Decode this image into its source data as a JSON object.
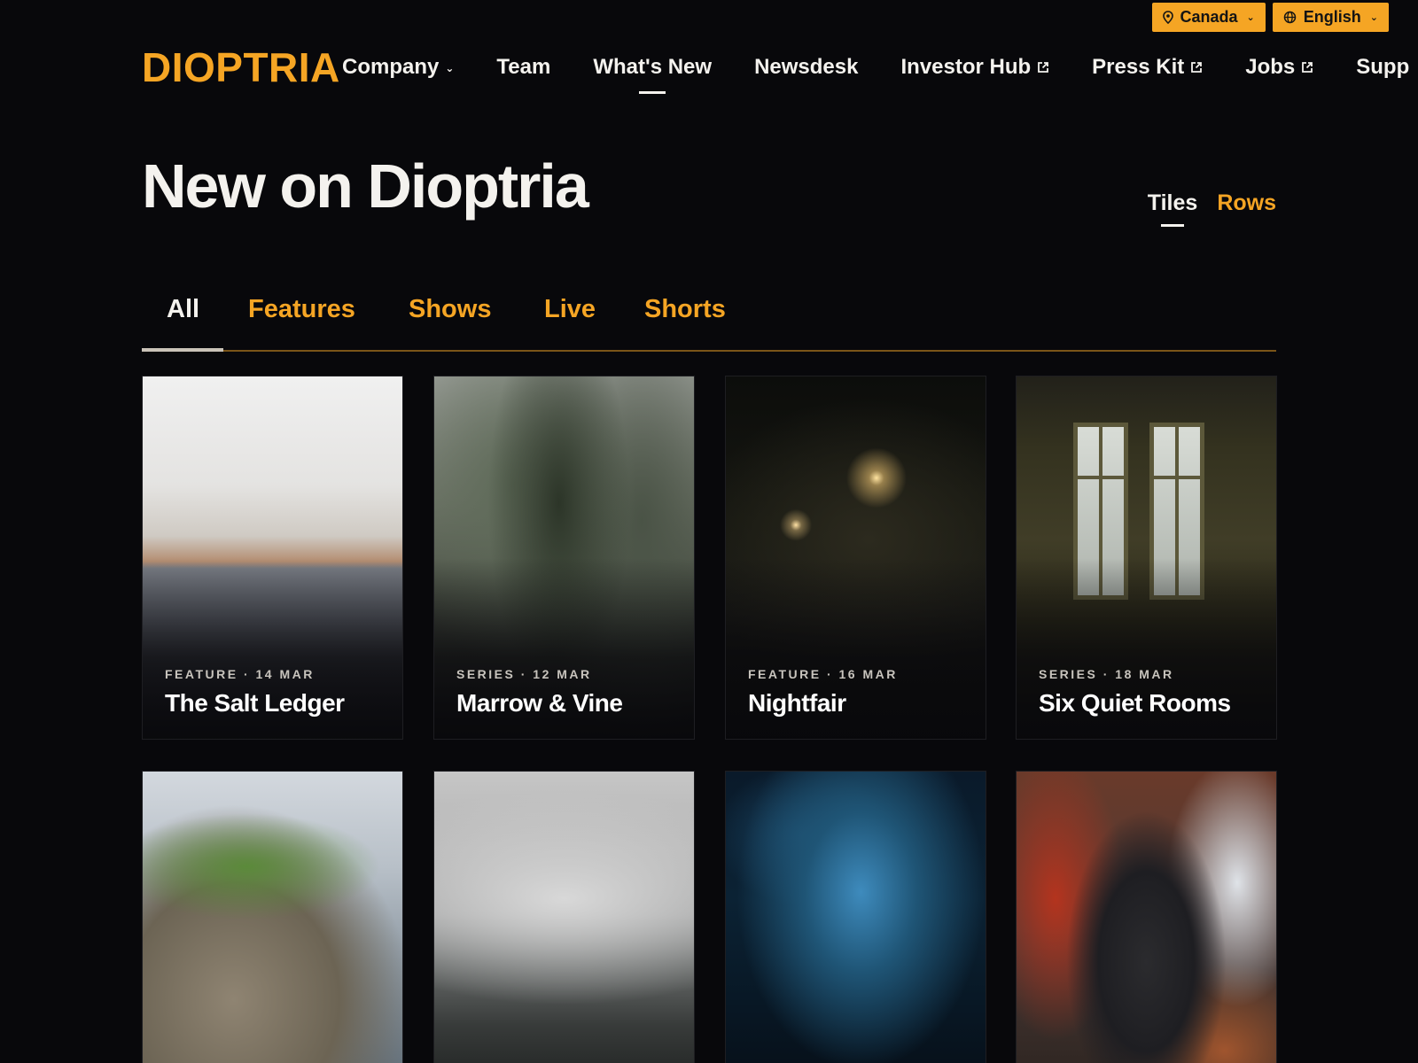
{
  "utility": {
    "region_label": "Canada",
    "language_label": "English",
    "icons": {
      "region": "map-pin-icon",
      "language": "globe-icon",
      "caret": "chevron-down-icon"
    }
  },
  "brand": {
    "logo_text": "DIOPTRIA",
    "accent_color": "#f5a524"
  },
  "nav": {
    "items": [
      {
        "label": "Company",
        "has_dropdown": true,
        "external": false,
        "active": false
      },
      {
        "label": "Team",
        "has_dropdown": false,
        "external": false,
        "active": false
      },
      {
        "label": "What's New",
        "has_dropdown": false,
        "external": false,
        "active": true
      },
      {
        "label": "Newsdesk",
        "has_dropdown": false,
        "external": false,
        "active": false
      },
      {
        "label": "Investor Hub",
        "has_dropdown": false,
        "external": true,
        "active": false
      },
      {
        "label": "Press Kit",
        "has_dropdown": false,
        "external": true,
        "active": false
      },
      {
        "label": "Jobs",
        "has_dropdown": false,
        "external": true,
        "active": false
      },
      {
        "label": "Supp",
        "has_dropdown": false,
        "external": false,
        "active": false
      }
    ]
  },
  "page": {
    "title": "New on Dioptria"
  },
  "view_toggle": {
    "options": [
      "Tiles",
      "Rows"
    ],
    "selected": "Tiles"
  },
  "filters": {
    "tabs": [
      "All",
      "Features",
      "Shows",
      "Live",
      "Shorts"
    ],
    "selected": "All"
  },
  "tiles": [
    {
      "meta": "FEATURE · 14 MAR",
      "title": "The Salt Ledger"
    },
    {
      "meta": "SERIES · 12 MAR",
      "title": "Marrow & Vine"
    },
    {
      "meta": "FEATURE · 16 MAR",
      "title": "Nightfair"
    },
    {
      "meta": "SERIES · 18 MAR",
      "title": "Six Quiet Rooms"
    }
  ],
  "colors": {
    "background": "#08080b",
    "text": "#f4f2ee",
    "accent": "#f5a524",
    "divider": "#7a5518"
  }
}
